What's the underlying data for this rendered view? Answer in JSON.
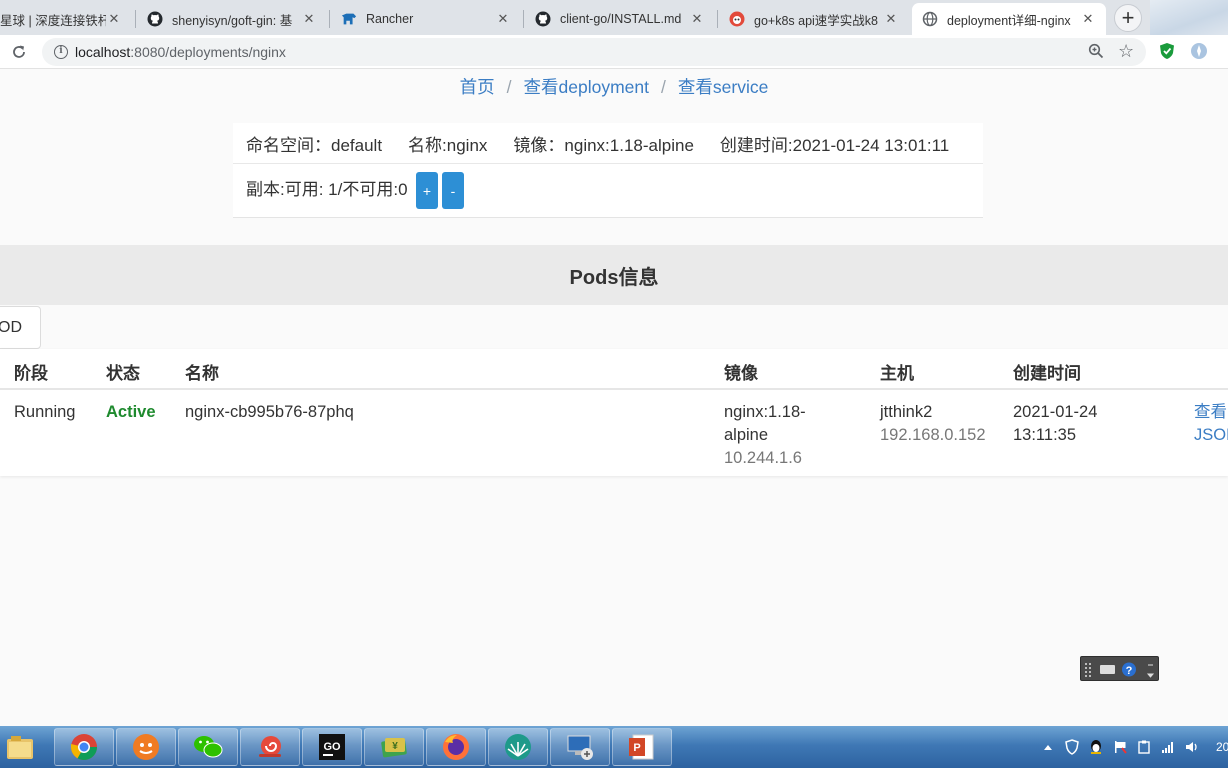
{
  "browser": {
    "tabs": [
      {
        "title": "星球 | 深度连接铁杆"
      },
      {
        "title": "shenyisyn/goft-gin: 基"
      },
      {
        "title": "Rancher"
      },
      {
        "title": "client-go/INSTALL.md"
      },
      {
        "title": "go+k8s api速学实战k8"
      },
      {
        "title": "deployment详细-nginx"
      }
    ],
    "url_host": "localhost",
    "url_rest": ":8080/deployments/nginx"
  },
  "breadcrumb": {
    "home": "首页",
    "deployments": "查看deployment",
    "services": "查看service",
    "separator": "/"
  },
  "deployment": {
    "namespace": "命名空间：default",
    "name": "名称:nginx",
    "image": "镜像：nginx:1.18-alpine",
    "created": "创建时间:2021-01-24 13:01:11",
    "replicas": "副本:可用: 1/不可用:0",
    "scale_up_label": "+",
    "scale_down_label": "-"
  },
  "pods": {
    "header": "Pods信息",
    "tab_label": "OD",
    "columns": {
      "phase": "阶段",
      "status": "状态",
      "name": "名称",
      "image": "镜像",
      "host": "主机",
      "created": "创建时间"
    },
    "rows": [
      {
        "phase": "Running",
        "status": "Active",
        "name": "nginx-cb995b76-87phq",
        "image_line1": "nginx:1.18-",
        "image_line2": "alpine",
        "pod_ip": "10.244.1.6",
        "host_name": "jtthink2",
        "host_ip": "192.168.0.152",
        "created_date": "2021-01-24",
        "created_time": "13:11:35",
        "action_view": "查看",
        "action_json": "JSON"
      }
    ]
  },
  "taskbar": {
    "clock_fragment": "20"
  },
  "colors": {
    "link": "#3b7dc4",
    "active_status": "#1e8a2e",
    "button_blue": "#2d8fd5",
    "taskbar": "#3f78b5"
  }
}
